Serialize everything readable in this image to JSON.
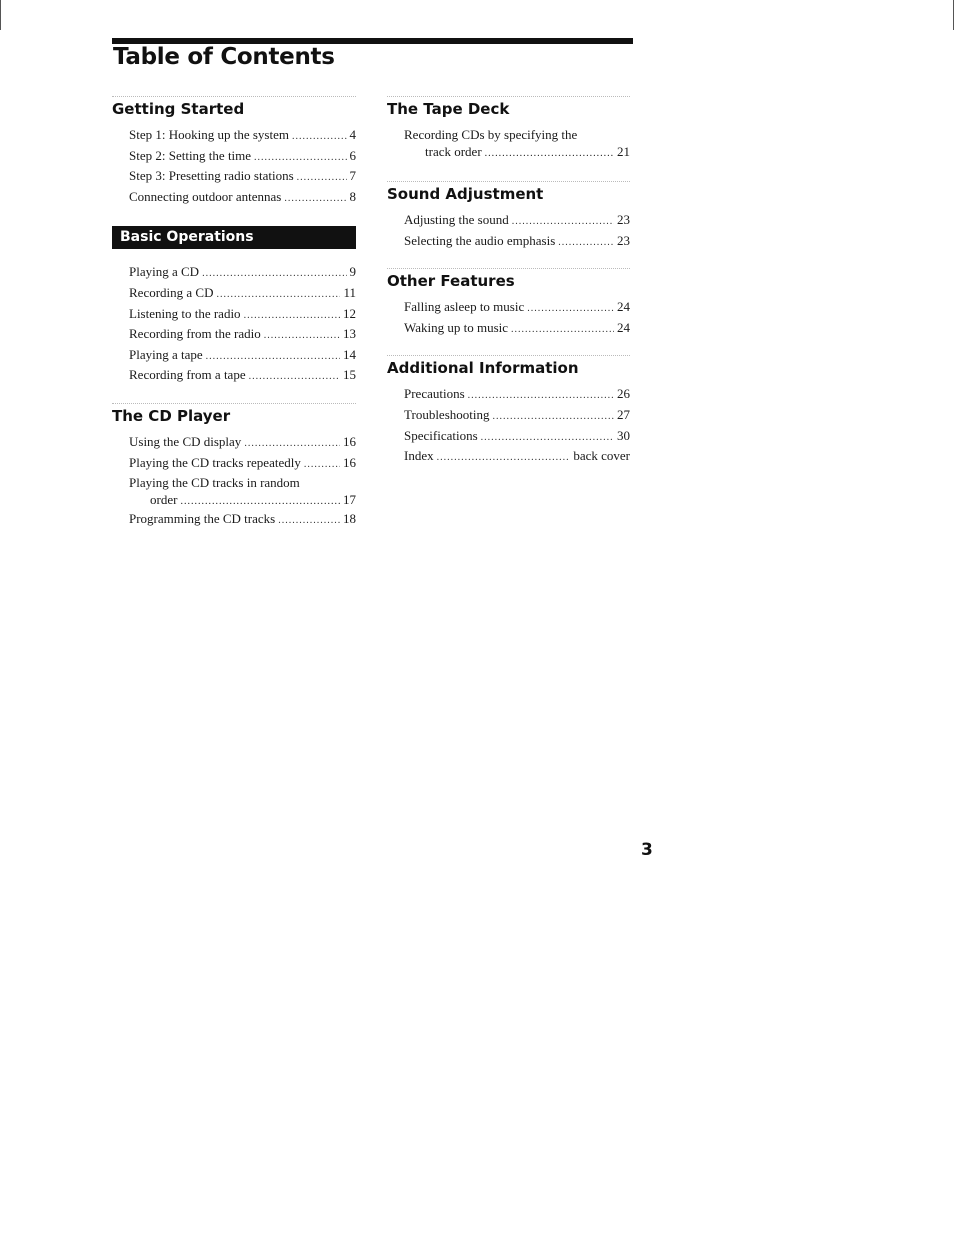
{
  "title": "Table of Contents",
  "page_number": "3",
  "left_column": [
    {
      "heading": "Getting Started",
      "boxed": false,
      "entries": [
        {
          "label": "Step 1:  Hooking up the system",
          "page": "4"
        },
        {
          "label": "Step 2:  Setting the time",
          "page": "6"
        },
        {
          "label": "Step 3:  Presetting radio stations",
          "page": "7"
        },
        {
          "label": "Connecting outdoor antennas",
          "page": "8"
        }
      ]
    },
    {
      "heading": "Basic Operations",
      "boxed": true,
      "entries": [
        {
          "label": "Playing a CD",
          "page": "9"
        },
        {
          "label": "Recording a CD",
          "page": "11"
        },
        {
          "label": "Listening to the radio",
          "page": "12"
        },
        {
          "label": "Recording from the radio",
          "page": "13"
        },
        {
          "label": "Playing a tape",
          "page": "14"
        },
        {
          "label": "Recording from a tape",
          "page": "15"
        }
      ]
    },
    {
      "heading": "The CD Player",
      "boxed": false,
      "entries": [
        {
          "label": "Using the CD display",
          "page": "16"
        },
        {
          "label": "Playing the CD tracks repeatedly",
          "page": "16"
        },
        {
          "label": "Playing the CD tracks in random",
          "continuation": "order",
          "page": "17"
        },
        {
          "label": "Programming the CD tracks",
          "page": "18"
        }
      ]
    }
  ],
  "right_column": [
    {
      "heading": "The Tape Deck",
      "boxed": false,
      "entries": [
        {
          "label": "Recording CDs by specifying the",
          "continuation": "track order",
          "page": "21"
        }
      ]
    },
    {
      "heading": "Sound Adjustment",
      "boxed": false,
      "entries": [
        {
          "label": "Adjusting the sound",
          "page": "23"
        },
        {
          "label": "Selecting the audio emphasis",
          "page": "23"
        }
      ]
    },
    {
      "heading": "Other Features",
      "boxed": false,
      "entries": [
        {
          "label": "Falling asleep to music",
          "page": "24"
        },
        {
          "label": "Waking up to music",
          "page": "24"
        }
      ]
    },
    {
      "heading": "Additional Information",
      "boxed": false,
      "entries": [
        {
          "label": "Precautions",
          "page": "26"
        },
        {
          "label": "Troubleshooting",
          "page": "27"
        },
        {
          "label": "Specifications",
          "page": "30"
        },
        {
          "label": "Index",
          "page": "back cover"
        }
      ]
    }
  ]
}
